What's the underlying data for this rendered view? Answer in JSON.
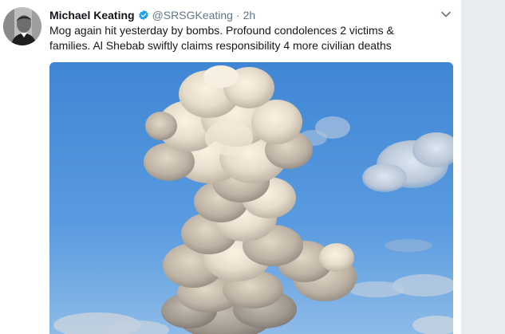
{
  "tweet": {
    "author_name": "Michael Keating",
    "handle": "@SRSGKeating",
    "separator": "·",
    "timestamp": "2h",
    "text_lines": [
      "Mog again hit yesterday by bombs. Profound condolences 2 victims &",
      "families. Al Shebab swiftly claims responsibility 4 more civilian deaths"
    ]
  },
  "icons": {
    "verified": "verified-badge-icon",
    "menu": "chevron-down-icon"
  },
  "colors": {
    "verified_blue": "#1da1f2",
    "muted_text": "#657786",
    "text": "#14171a",
    "gutter": "#e6ecf0",
    "sky": "#4a8fd8"
  }
}
